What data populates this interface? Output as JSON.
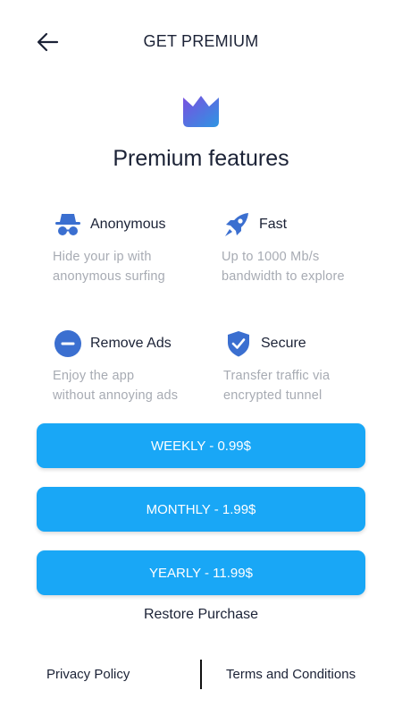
{
  "header": {
    "back_icon": "arrow-left-icon",
    "title": "GET PREMIUM"
  },
  "hero": {
    "icon": "crown-icon",
    "title": "Premium features"
  },
  "features": [
    {
      "icon": "incognito-icon",
      "title": "Anonymous",
      "description": "Hide your ip with\nanonymous surfing"
    },
    {
      "icon": "rocket-icon",
      "title": "Fast",
      "description": "Up to 1000 Mb/s\nbandwidth to explore"
    },
    {
      "icon": "minus-circle-icon",
      "title": "Remove Ads",
      "description": "Enjoy the app\nwithout annoying ads"
    },
    {
      "icon": "shield-check-icon",
      "title": "Secure",
      "description": "Transfer traffic via\nencrypted tunnel"
    }
  ],
  "plans": [
    {
      "label": "WEEKLY - 0.99$"
    },
    {
      "label": "MONTHLY - 1.99$"
    },
    {
      "label": "YEARLY - 11.99$"
    }
  ],
  "restore_label": "Restore Purchase",
  "footer": {
    "privacy_label": "Privacy Policy",
    "terms_label": "Terms and Conditions"
  },
  "colors": {
    "accent": "#19a7f6",
    "icon_blue": "#3b6fd0",
    "crown_gradient_start": "#6a5ae0",
    "crown_gradient_end": "#2f8fe0",
    "text_primary": "#1b2236",
    "text_secondary": "#a7abb3"
  }
}
